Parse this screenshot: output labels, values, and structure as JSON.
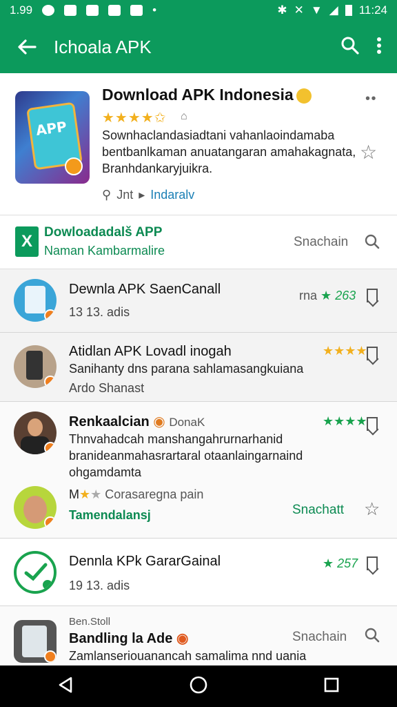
{
  "status_bar": {
    "time_left": "1.99",
    "time_right": "11:24"
  },
  "app_bar": {
    "title": "Ichoala APK"
  },
  "featured": {
    "title": "Download APK Indonesia",
    "stars": "★★★★✩",
    "icon_text": "APP",
    "description": "Sownhaclandasiadtani vahanlaoindamaba bentbanlkaman anuatangaran amahakagnata, Branhdankaryjuikra.",
    "meta_label": "Jnt",
    "meta_link": "Indaralv"
  },
  "section": {
    "title": "Dowloadadalš APP",
    "subtitle": "Naman Kambarmalire",
    "action": "Snachain"
  },
  "rows": [
    {
      "title": "Dewnla APK SaenCanall",
      "sub": "13 13. adis",
      "rating_prefix": "rna",
      "rating_value": "263"
    },
    {
      "title": "Atidlan APK Lovadl inogah",
      "text": "Sanihanty dns parana sahlamasangkuiana",
      "sub": "Ardo Shanast",
      "stars": "★★★★"
    },
    {
      "title": "Renkaalcian",
      "title_extra": "DonaK",
      "text": "Thnvahadcah manshangahrurnarhanid branideanmahasrartaral otaanlaingarnaind ohgamdamta",
      "stars": "★★★★"
    },
    {
      "title": "M",
      "title_extra": "Corasaregna pain",
      "link": "Tamendalansj",
      "action": "Snachatt"
    },
    {
      "title": "Dennla KPk GararGainal",
      "sub": "19 13. adis",
      "rating_value": "257"
    },
    {
      "kicker": "Ben.Stoll",
      "title": "Bandling la Ade",
      "text": "Zamlanseriouanancah samalima nnd uania",
      "action": "Snachain"
    }
  ]
}
